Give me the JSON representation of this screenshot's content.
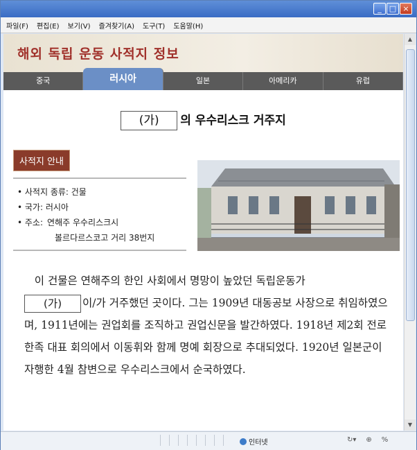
{
  "menu": [
    "파일(F)",
    "편집(E)",
    "보기(V)",
    "즐겨찾기(A)",
    "도구(T)",
    "도움말(H)"
  ],
  "window_buttons": {
    "minimize": "_",
    "maximize": "□",
    "close": "×"
  },
  "site_title": "해외 독립 운동 사적지 정보",
  "tabs": [
    "중국",
    "러시아",
    "일본",
    "아메리카",
    "유럽"
  ],
  "active_tab": "러시아",
  "heading": {
    "blank": "(가)",
    "rest": "의 우수리스크 거주지"
  },
  "guide_label": "사적지 안내",
  "info": {
    "type": "• 사적지 종류: 건물",
    "country": "• 국가: 러시아",
    "address_key": "• 주소:",
    "address_line1": "연해주 우수리스크시",
    "address_line2": "볼르다르스코고 거리 38번지"
  },
  "body": {
    "line1": "이 건물은 연해주의 한인 사회에서 명망이 높았던 독립운동가",
    "blank": "(가)",
    "rest": "이/가 거주했던 곳이다. 그는 1909년 대동공보 사장으로 취임하였으며, 1911년에는 권업회를 조직하고 권업신문을 발간하였다. 1918년 제2회 전로 한족 대표 회의에서 이동휘와 함께 명예 회장으로 추대되었다. 1920년 일본군이 자행한 4월 참변으로 우수리스크에서 순국하였다."
  },
  "status": {
    "zone": "인터넷",
    "zoom": "%"
  },
  "colors": {
    "title": "#a0302a",
    "tab_active": "#6b8fc6",
    "label_bg": "#8a3b2a"
  }
}
